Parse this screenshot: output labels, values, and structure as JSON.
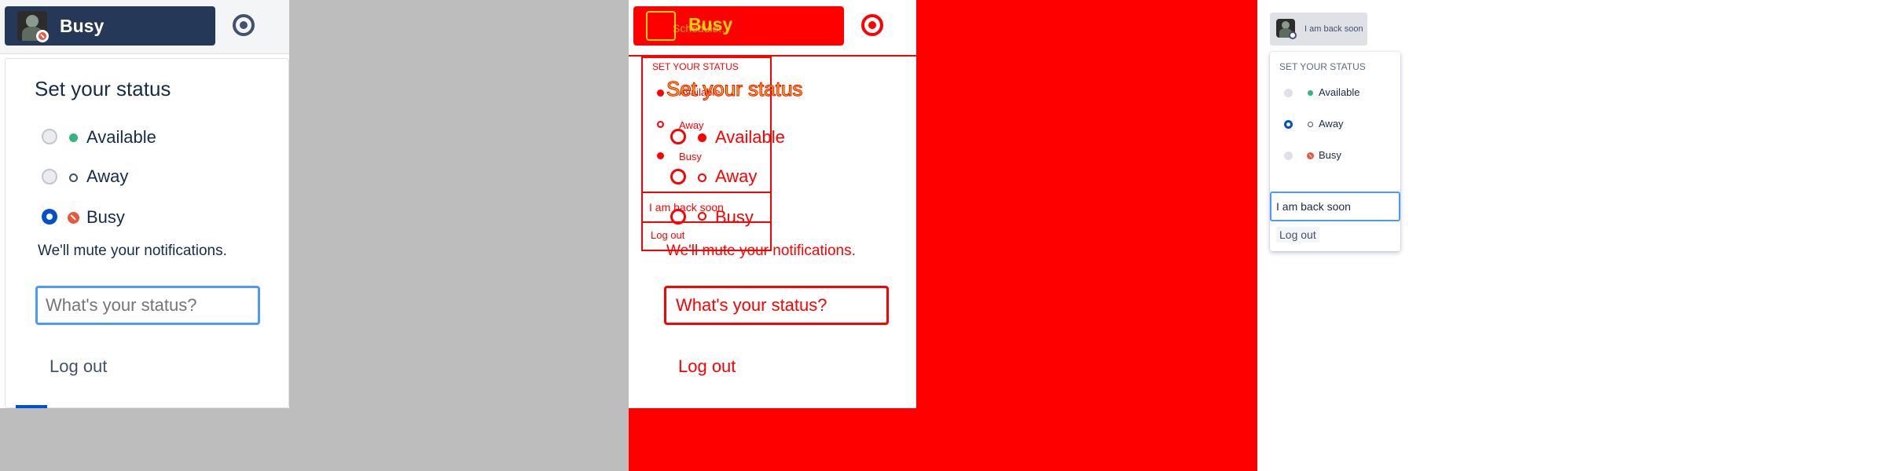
{
  "colors": {
    "header_bg": "#253858",
    "gray_bg": "#bdbdbd",
    "red_bg": "#ff0000",
    "highlight": "#ffd700",
    "available": "#36b37e",
    "away": "#42526e",
    "busy": "#e8573f",
    "radio_checked": "#0052cc"
  },
  "icons": {
    "avatar": "user-avatar-icon",
    "status_badge": "busy-status-icon",
    "target": "target-icon"
  },
  "panel1": {
    "header": {
      "status_label": "Busy"
    },
    "menu": {
      "title": "Set your status",
      "options": [
        {
          "label": "Available",
          "checked": false
        },
        {
          "label": "Away",
          "checked": false
        },
        {
          "label": "Busy",
          "checked": true
        }
      ],
      "note": "We'll mute your notifications.",
      "status_input": {
        "value": "",
        "placeholder": "What's your status?"
      },
      "logout": "Log out"
    }
  },
  "panel2": {
    "header": {
      "status_label": "Busy",
      "overlap_text": "Schedule..."
    },
    "menu_small": {
      "heading": "SET YOUR STATUS",
      "options": [
        "Available",
        "Away",
        "Busy"
      ],
      "status_value": "I am back soon",
      "logout": "Log out"
    },
    "menu": {
      "title": "Set your status",
      "options": [
        "Available",
        "Away",
        "Busy"
      ],
      "note": "We'll mute your notifications.",
      "status_input": "What's your status?",
      "logout": "Log out"
    }
  },
  "panel3": {
    "header": {
      "status_label": "I am back soon"
    },
    "menu": {
      "heading": "SET YOUR STATUS",
      "options": [
        {
          "label": "Available",
          "checked": false
        },
        {
          "label": "Away",
          "checked": true
        },
        {
          "label": "Busy",
          "checked": false
        }
      ],
      "status_input": {
        "value": "I am back soon",
        "placeholder": ""
      },
      "logout": "Log out"
    }
  }
}
